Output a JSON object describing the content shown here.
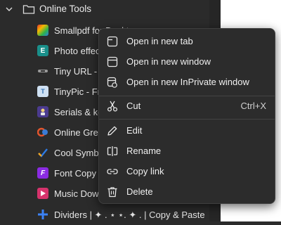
{
  "tree": {
    "folder": {
      "label": "Online Tools",
      "icon": "folder-icon",
      "expanded": true
    },
    "items": [
      {
        "label": "Smallpdf for Desktop",
        "icon": "smallpdf-icon",
        "color": "#e5322d"
      },
      {
        "label": "Photo effects",
        "icon": "photo-effects-icon",
        "color": "#1a8f8a"
      },
      {
        "label": "Tiny URL - cu",
        "icon": "tinyurl-icon",
        "color": "#3a3a3a"
      },
      {
        "label": "TinyPic - Free",
        "icon": "tinypic-icon",
        "color": "#2f6fb2"
      },
      {
        "label": "Serials & key",
        "icon": "serials-icon",
        "color": "#7a6ad0"
      },
      {
        "label": "Online Greeti",
        "icon": "greetings-icon",
        "color": "#e2552d"
      },
      {
        "label": "Cool Symbol",
        "icon": "checkmark-icon",
        "color": "#2d7be5"
      },
      {
        "label": "Font Copy an",
        "icon": "font-copy-icon",
        "color": "#8a2be2"
      },
      {
        "label": "Music Down",
        "icon": "music-icon",
        "color": "#d6336c"
      },
      {
        "label": "Dividers | ✦ .  ⋆    ⋆. ✦ . | Copy & Paste",
        "icon": "plus-icon",
        "color": "#3b82f6"
      }
    ]
  },
  "context_menu": {
    "items": [
      {
        "label": "Open in new tab",
        "icon": "new-tab-icon",
        "shortcut": ""
      },
      {
        "label": "Open in new window",
        "icon": "new-window-icon",
        "shortcut": ""
      },
      {
        "label": "Open in new InPrivate window",
        "icon": "inprivate-window-icon",
        "shortcut": ""
      },
      {
        "label": "Cut",
        "icon": "scissors-icon",
        "shortcut": "Ctrl+X"
      },
      {
        "label": "Edit",
        "icon": "pencil-icon",
        "shortcut": ""
      },
      {
        "label": "Rename",
        "icon": "rename-icon",
        "shortcut": ""
      },
      {
        "label": "Copy link",
        "icon": "link-icon",
        "shortcut": ""
      },
      {
        "label": "Delete",
        "icon": "trash-icon",
        "shortcut": ""
      }
    ]
  }
}
